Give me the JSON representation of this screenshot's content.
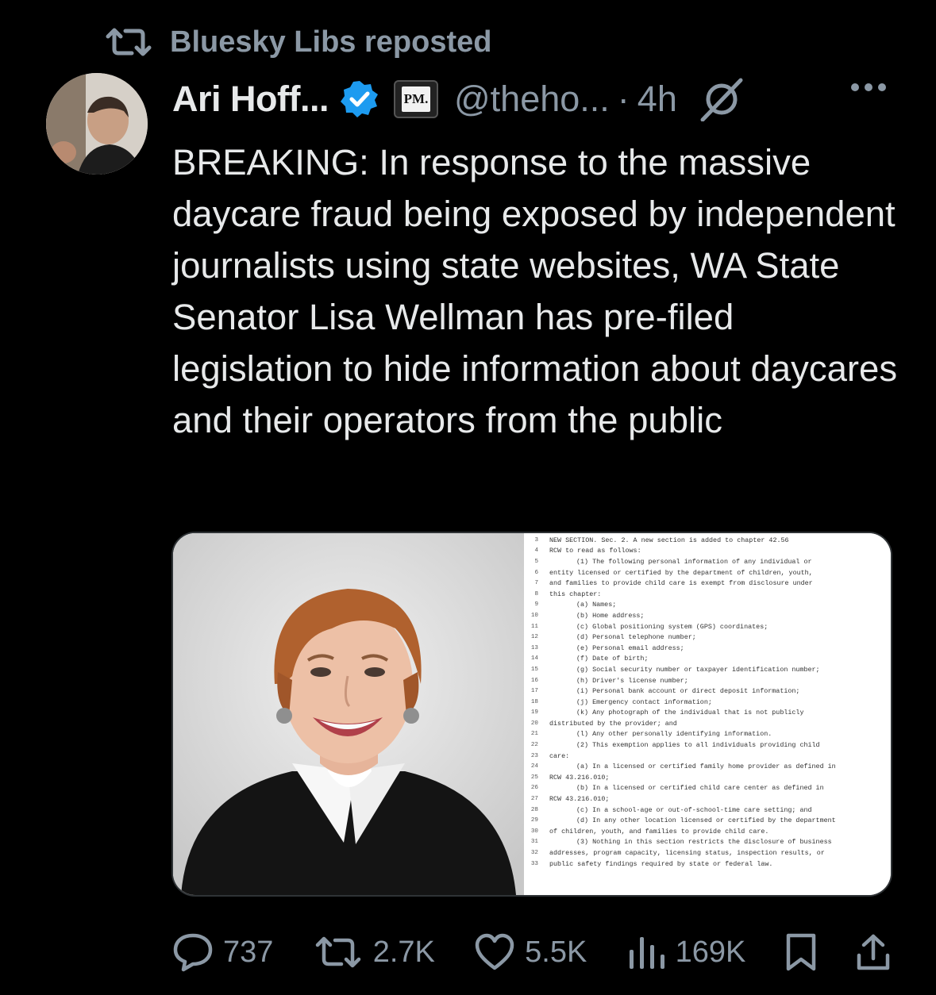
{
  "repost": {
    "icon": "repost-icon",
    "text": "Bluesky Libs reposted"
  },
  "post": {
    "author_name": "Ari Hoff...",
    "verified_icon": "verified-badge-icon",
    "affiliate_badge": "PM.",
    "handle": "@theho...",
    "separator": "·",
    "time": "4h",
    "grok_icon": "grok-icon",
    "more_icon": "more-icon",
    "text": "BREAKING: In response to the massive daycare fraud being exposed by independent journalists using state websites, WA State Senator Lisa Wellman has pre-filed legislation to hide information about daycares and their operators from the public"
  },
  "media": {
    "photo": "woman-portrait",
    "document_lines": [
      {
        "n": "3",
        "t": "NEW SECTION.  Sec. 2.  A new section is added to chapter 42.56",
        "indent": false
      },
      {
        "n": "4",
        "t": "RCW to read as follows:",
        "indent": false
      },
      {
        "n": "5",
        "t": "(1)  The  following  personal  information  of  any  individual  or",
        "indent": true
      },
      {
        "n": "6",
        "t": "entity licensed or certified by the department of children, youth,",
        "indent": false
      },
      {
        "n": "7",
        "t": "and families to provide child care is exempt from disclosure under",
        "indent": false
      },
      {
        "n": "8",
        "t": "this chapter:",
        "indent": false
      },
      {
        "n": "9",
        "t": "(a) Names;",
        "indent": true
      },
      {
        "n": "10",
        "t": "(b) Home address;",
        "indent": true
      },
      {
        "n": "11",
        "t": "(c) Global positioning system (GPS) coordinates;",
        "indent": true
      },
      {
        "n": "12",
        "t": "(d) Personal telephone number;",
        "indent": true
      },
      {
        "n": "13",
        "t": "(e) Personal email address;",
        "indent": true
      },
      {
        "n": "14",
        "t": "(f) Date of birth;",
        "indent": true
      },
      {
        "n": "15",
        "t": "(g) Social security number or taxpayer identification number;",
        "indent": true
      },
      {
        "n": "16",
        "t": "(h) Driver's license number;",
        "indent": true
      },
      {
        "n": "17",
        "t": "(i) Personal bank account or direct deposit information;",
        "indent": true
      },
      {
        "n": "18",
        "t": "(j) Emergency contact information;",
        "indent": true
      },
      {
        "n": "19",
        "t": "(k)  Any  photograph  of  the  individual  that  is  not  publicly",
        "indent": true
      },
      {
        "n": "20",
        "t": "distributed by the provider; and",
        "indent": false
      },
      {
        "n": "21",
        "t": "(l) Any other personally identifying information.",
        "indent": true
      },
      {
        "n": "22",
        "t": "(2)  This  exemption  applies  to  all  individuals  providing  child",
        "indent": true
      },
      {
        "n": "23",
        "t": "care:",
        "indent": false
      },
      {
        "n": "24",
        "t": "(a) In a licensed or certified family home provider as defined in",
        "indent": true
      },
      {
        "n": "25",
        "t": "RCW 43.216.010;",
        "indent": false
      },
      {
        "n": "26",
        "t": "(b)  In  a  licensed  or  certified  child  care  center  as  defined  in",
        "indent": true
      },
      {
        "n": "27",
        "t": "RCW 43.216.010;",
        "indent": false
      },
      {
        "n": "28",
        "t": "(c) In a school-age or out-of-school-time care setting; and",
        "indent": true
      },
      {
        "n": "29",
        "t": "(d) In any other location licensed or certified by the department",
        "indent": true
      },
      {
        "n": "30",
        "t": "of children, youth, and families to provide child care.",
        "indent": false
      },
      {
        "n": "31",
        "t": "(3) Nothing in this section restricts the disclosure of business",
        "indent": true
      },
      {
        "n": "32",
        "t": "addresses, program capacity, licensing status, inspection results, or",
        "indent": false
      },
      {
        "n": "33",
        "t": "public safety findings required by state or federal law.",
        "indent": false
      }
    ]
  },
  "actions": {
    "reply": {
      "icon": "reply-icon",
      "count": "737"
    },
    "repost": {
      "icon": "repost-icon",
      "count": "2.7K"
    },
    "like": {
      "icon": "heart-icon",
      "count": "5.5K"
    },
    "views": {
      "icon": "views-icon",
      "count": "169K"
    },
    "bookmark": {
      "icon": "bookmark-icon"
    },
    "share": {
      "icon": "share-icon"
    }
  }
}
